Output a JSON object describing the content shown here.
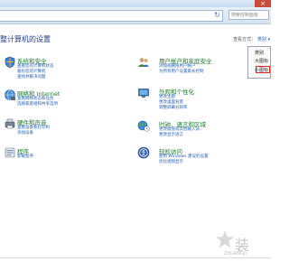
{
  "window": {
    "close_glyph": "×"
  },
  "address": {
    "refresh_glyph": "↻"
  },
  "search": {
    "placeholder": "搜索控制面板"
  },
  "header": {
    "title": "整计算机的设置",
    "view_by_label": "查看方式：",
    "view_by_value": "类别 ▾"
  },
  "view_menu": {
    "options": [
      "类别",
      "大图标",
      "小图标"
    ],
    "selected": "类别"
  },
  "categories": [
    {
      "title": "系统和安全",
      "icon": "system-security-icon",
      "links": [
        "查看您的计算机状态",
        "备份您的计算机",
        "查找并解决问题"
      ]
    },
    {
      "title": "网络和 Internet",
      "icon": "network-internet-icon",
      "links": [
        "查看网络状态和任务",
        "选择家庭组和共享选项"
      ]
    },
    {
      "title": "硬件和声音",
      "icon": "hardware-sound-icon",
      "links": [
        "查看设备和打印机",
        "添加设备"
      ]
    },
    {
      "title": "程序",
      "icon": "programs-icon",
      "links": [
        "卸载程序"
      ]
    },
    {
      "title": "用户帐户和家庭安全",
      "icon": "user-accounts-icon",
      "links": [
        "添加或删除用户帐户",
        "为所有用户设置家长控制"
      ]
    },
    {
      "title": "外观和个性化",
      "icon": "appearance-icon",
      "links": [
        "更改主题",
        "更改桌面背景",
        "调整屏幕分辨率"
      ]
    },
    {
      "title": "时钟、语言和区域",
      "icon": "clock-language-icon",
      "links": [
        "更改键盘或其他输入法",
        "更改显示语言"
      ]
    },
    {
      "title": "轻松访问",
      "icon": "ease-of-access-icon",
      "links": [
        "使用 Windows 建议的设置",
        "优化视频显示"
      ]
    }
  ],
  "watermark": {
    "text": "装",
    "sub": "ZHUANGJI"
  }
}
